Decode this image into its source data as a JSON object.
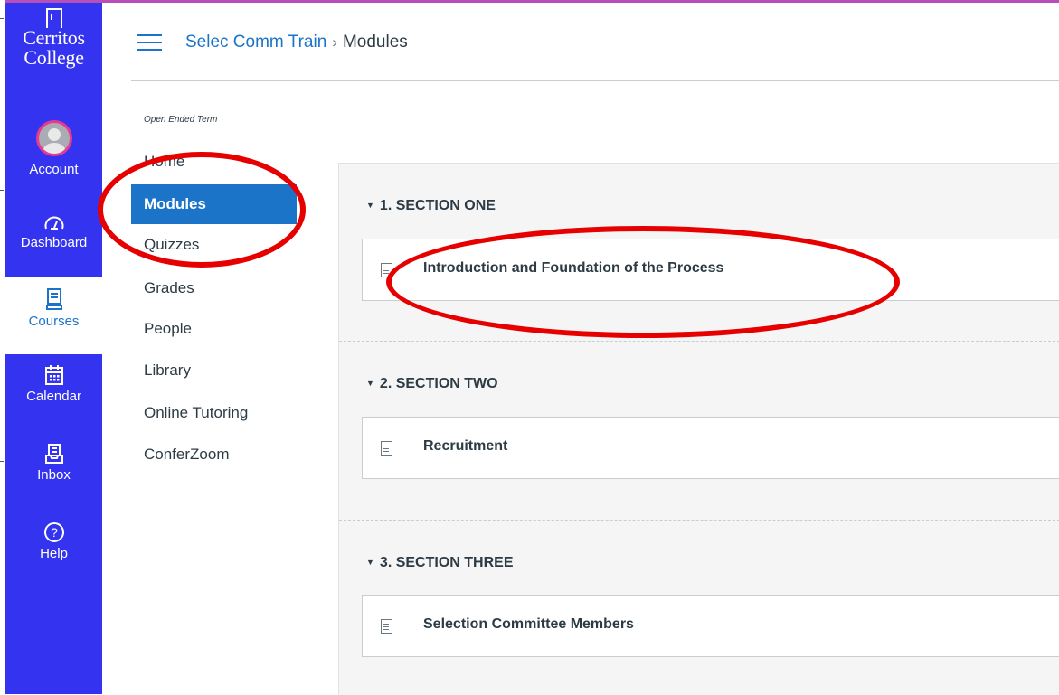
{
  "global_nav": {
    "logo": {
      "line1": "Cerritos",
      "line2": "College"
    },
    "items": [
      {
        "label": "Account",
        "icon": "avatar"
      },
      {
        "label": "Dashboard",
        "icon": "dashboard-icon"
      },
      {
        "label": "Courses",
        "icon": "courses-icon",
        "active": true
      },
      {
        "label": "Calendar",
        "icon": "calendar-icon"
      },
      {
        "label": "Inbox",
        "icon": "inbox-icon"
      },
      {
        "label": "Help",
        "icon": "help-icon"
      }
    ]
  },
  "header": {
    "course": "Selec Comm Train",
    "separator": "›",
    "current": "Modules"
  },
  "course_nav": {
    "term": "Open Ended Term",
    "items": [
      {
        "label": "Home"
      },
      {
        "label": "Modules",
        "active": true
      },
      {
        "label": "Quizzes"
      },
      {
        "label": "Grades"
      },
      {
        "label": "People"
      },
      {
        "label": "Library"
      },
      {
        "label": "Online Tutoring"
      },
      {
        "label": "ConferZoom"
      }
    ]
  },
  "modules": [
    {
      "name": "1. SECTION ONE",
      "items": [
        {
          "title": "Introduction and Foundation of the Process",
          "icon": "document-icon"
        }
      ]
    },
    {
      "name": "2. SECTION TWO",
      "items": [
        {
          "title": "Recruitment",
          "icon": "document-icon"
        }
      ]
    },
    {
      "name": "3. SECTION THREE",
      "items": [
        {
          "title": "Selection Committee Members",
          "icon": "document-icon"
        }
      ]
    }
  ],
  "colors": {
    "nav_bg": "#3333f0",
    "accent": "#1b74c8",
    "annotation": "#e60000"
  }
}
